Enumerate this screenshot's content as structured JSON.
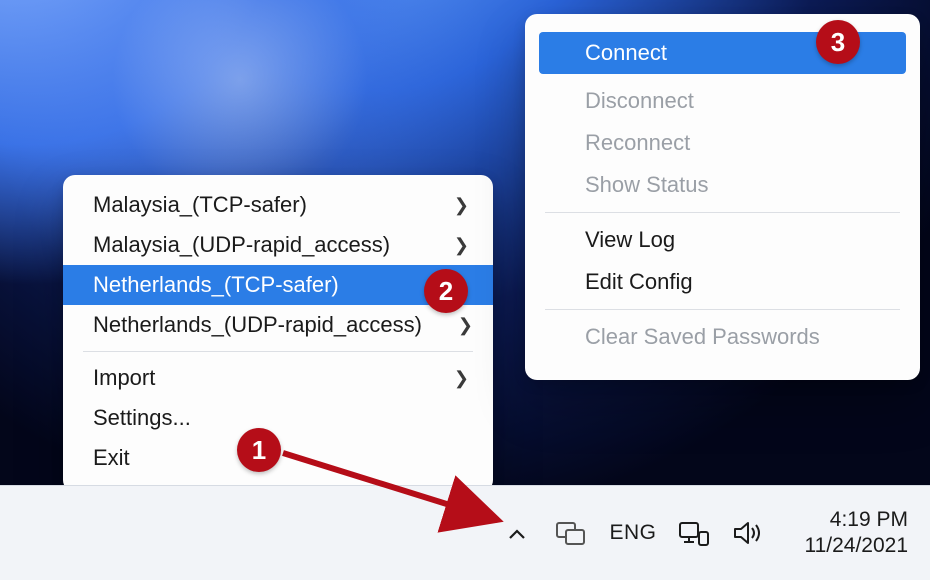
{
  "left_menu": {
    "servers": [
      {
        "label": "Malaysia_(TCP-safer)"
      },
      {
        "label": "Malaysia_(UDP-rapid_access)"
      },
      {
        "label": "Netherlands_(TCP-safer)"
      },
      {
        "label": "Netherlands_(UDP-rapid_access)"
      }
    ],
    "import": "Import",
    "settings": "Settings...",
    "exit": "Exit"
  },
  "right_menu": {
    "connect": "Connect",
    "disconnect": "Disconnect",
    "reconnect": "Reconnect",
    "show_status": "Show Status",
    "view_log": "View Log",
    "edit_config": "Edit Config",
    "clear_passwords": "Clear Saved Passwords"
  },
  "tray": {
    "lang": "ENG",
    "time": "4:19 PM",
    "date": "11/24/2021"
  },
  "annotations": {
    "b1": "1",
    "b2": "2",
    "b3": "3"
  }
}
